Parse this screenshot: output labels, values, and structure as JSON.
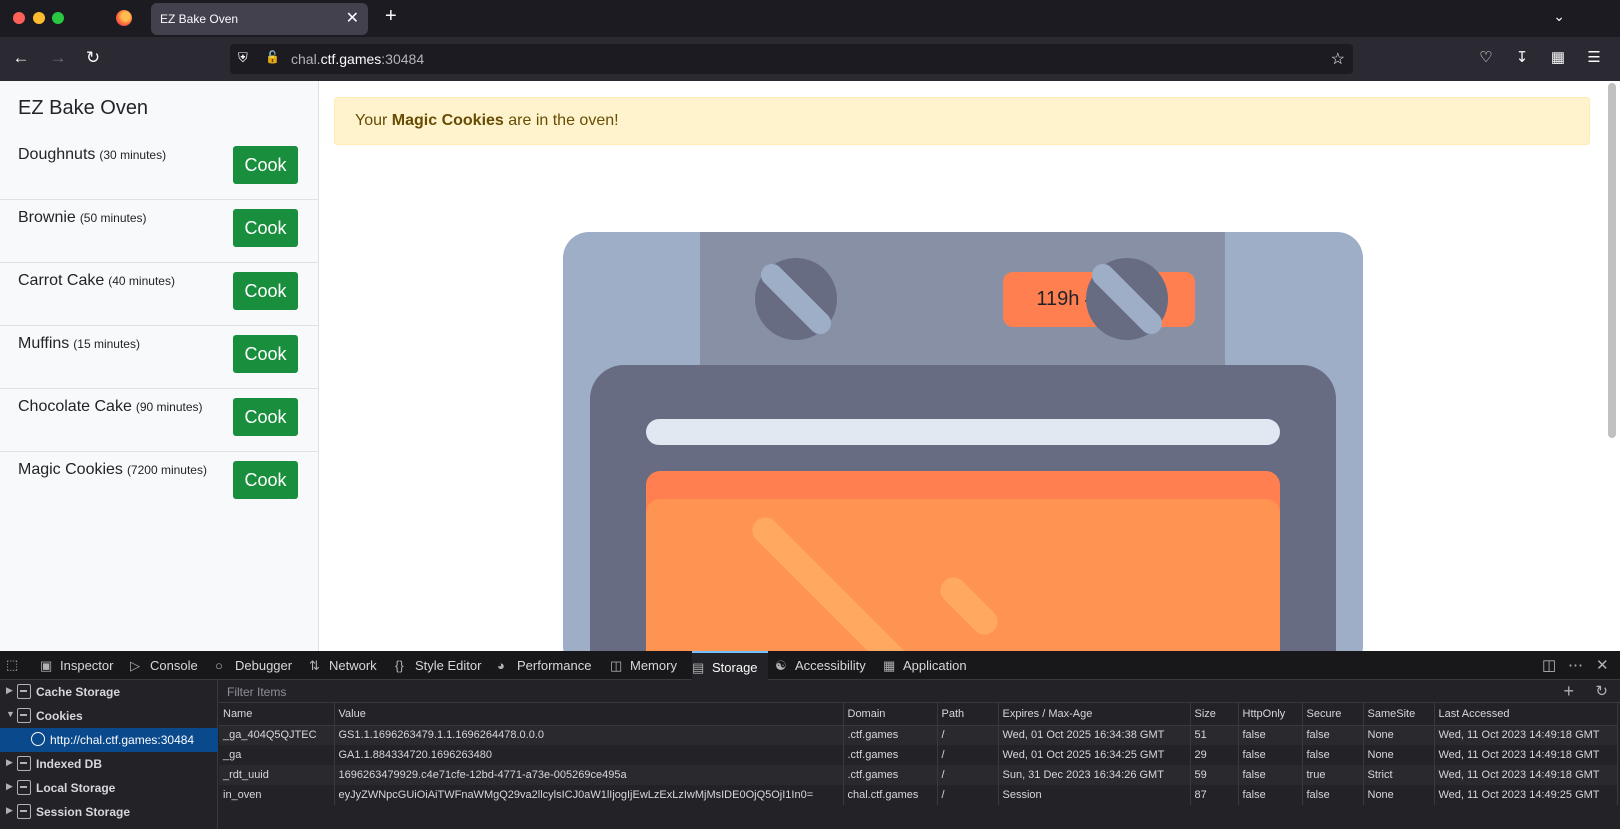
{
  "browser": {
    "tab_title": "EZ Bake Oven",
    "tab_close": "✕",
    "new_tab": "+",
    "url_host_prefix": "chal.",
    "url_host_main": "ctf.games",
    "url_port": ":30484"
  },
  "sidebar": {
    "title": "EZ Bake Oven",
    "recipes": [
      {
        "name": "Doughnuts",
        "time": "(30 minutes)",
        "button": "Cook"
      },
      {
        "name": "Brownie",
        "time": "(50 minutes)",
        "button": "Cook"
      },
      {
        "name": "Carrot Cake",
        "time": "(40 minutes)",
        "button": "Cook"
      },
      {
        "name": "Muffins",
        "time": "(15 minutes)",
        "button": "Cook"
      },
      {
        "name": "Chocolate Cake",
        "time": "(90 minutes)",
        "button": "Cook"
      },
      {
        "name": "Magic Cookies",
        "time": "(7200 minutes)",
        "button": "Cook"
      }
    ]
  },
  "alert": {
    "prefix": "Your ",
    "item": "Magic Cookies",
    "suffix": " are in the oven!"
  },
  "oven": {
    "timer": "119h 45m 21s"
  },
  "devtools": {
    "tabs": [
      {
        "label": "Inspector",
        "icon": "inspector-icon"
      },
      {
        "label": "Console",
        "icon": "console-icon"
      },
      {
        "label": "Debugger",
        "icon": "debugger-icon"
      },
      {
        "label": "Network",
        "icon": "network-icon"
      },
      {
        "label": "Style Editor",
        "icon": "style-editor-icon"
      },
      {
        "label": "Performance",
        "icon": "performance-icon"
      },
      {
        "label": "Memory",
        "icon": "memory-icon"
      },
      {
        "label": "Storage",
        "icon": "storage-icon",
        "active": true
      },
      {
        "label": "Accessibility",
        "icon": "accessibility-icon"
      },
      {
        "label": "Application",
        "icon": "application-icon"
      }
    ],
    "tree": {
      "cache_storage": "Cache Storage",
      "cookies": "Cookies",
      "cookies_host": "http://chal.ctf.games:30484",
      "indexed_db": "Indexed DB",
      "local_storage": "Local Storage",
      "session_storage": "Session Storage"
    },
    "filter_placeholder": "Filter Items",
    "columns": [
      "Name",
      "Value",
      "Domain",
      "Path",
      "Expires / Max-Age",
      "Size",
      "HttpOnly",
      "Secure",
      "SameSite",
      "Last Accessed"
    ],
    "rows": [
      [
        "_ga_404Q5QJTEC",
        "GS1.1.1696263479.1.1.1696264478.0.0.0",
        ".ctf.games",
        "/",
        "Wed, 01 Oct 2025 16:34:38 GMT",
        "51",
        "false",
        "false",
        "None",
        "Wed, 11 Oct 2023 14:49:18 GMT"
      ],
      [
        "_ga",
        "GA1.1.884334720.1696263480",
        ".ctf.games",
        "/",
        "Wed, 01 Oct 2025 16:34:25 GMT",
        "29",
        "false",
        "false",
        "None",
        "Wed, 11 Oct 2023 14:49:18 GMT"
      ],
      [
        "_rdt_uuid",
        "1696263479929.c4e71cfe-12bd-4771-a73e-005269ce495a",
        ".ctf.games",
        "/",
        "Sun, 31 Dec 2023 16:34:26 GMT",
        "59",
        "false",
        "true",
        "Strict",
        "Wed, 11 Oct 2023 14:49:18 GMT"
      ],
      [
        "in_oven",
        "eyJyZWNpcGUiOiAiTWFnaWMgQ29va2llcylsICJ0aW1lIjogIjEwLzExLzIwMjMsIDE0OjQ5OjI1In0=",
        "chal.ctf.games",
        "/",
        "Session",
        "87",
        "false",
        "false",
        "None",
        "Wed, 11 Oct 2023 14:49:25 GMT"
      ]
    ]
  }
}
